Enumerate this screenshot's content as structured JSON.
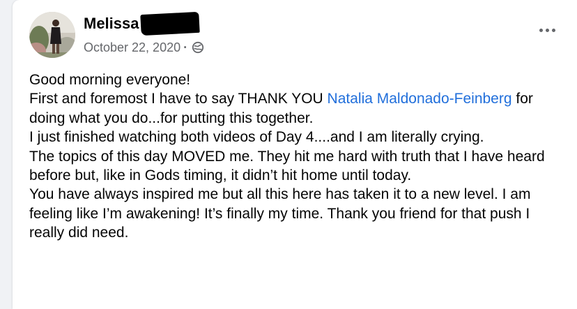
{
  "post": {
    "author_name": "Melissa",
    "date": "October 22, 2020",
    "separator": "·",
    "privacy_icon": "globe-icon",
    "more_icon": "more-options-icon",
    "line_1": "Good morning everyone!",
    "line_2_before": "First and foremost I have to say THANK YOU ",
    "mention": "Natalia Maldonado-Feinberg",
    "line_2_after": " for doing what you do...for putting this together.",
    "line_3": "I just finished watching both videos of Day 4....and I am literally crying.",
    "line_4": "The topics of this day MOVED me. They hit me hard with truth that I have heard before but, like in Gods timing, it didn’t hit home until today.",
    "line_5": "You have always inspired me but all this here has taken it to a new level. I am feeling like I’m awakening! It’s finally my time. Thank you friend for that push I really did need."
  },
  "colors": {
    "mention": "#216fdb",
    "meta_text": "#65676b",
    "background": "#f0f2f5"
  }
}
